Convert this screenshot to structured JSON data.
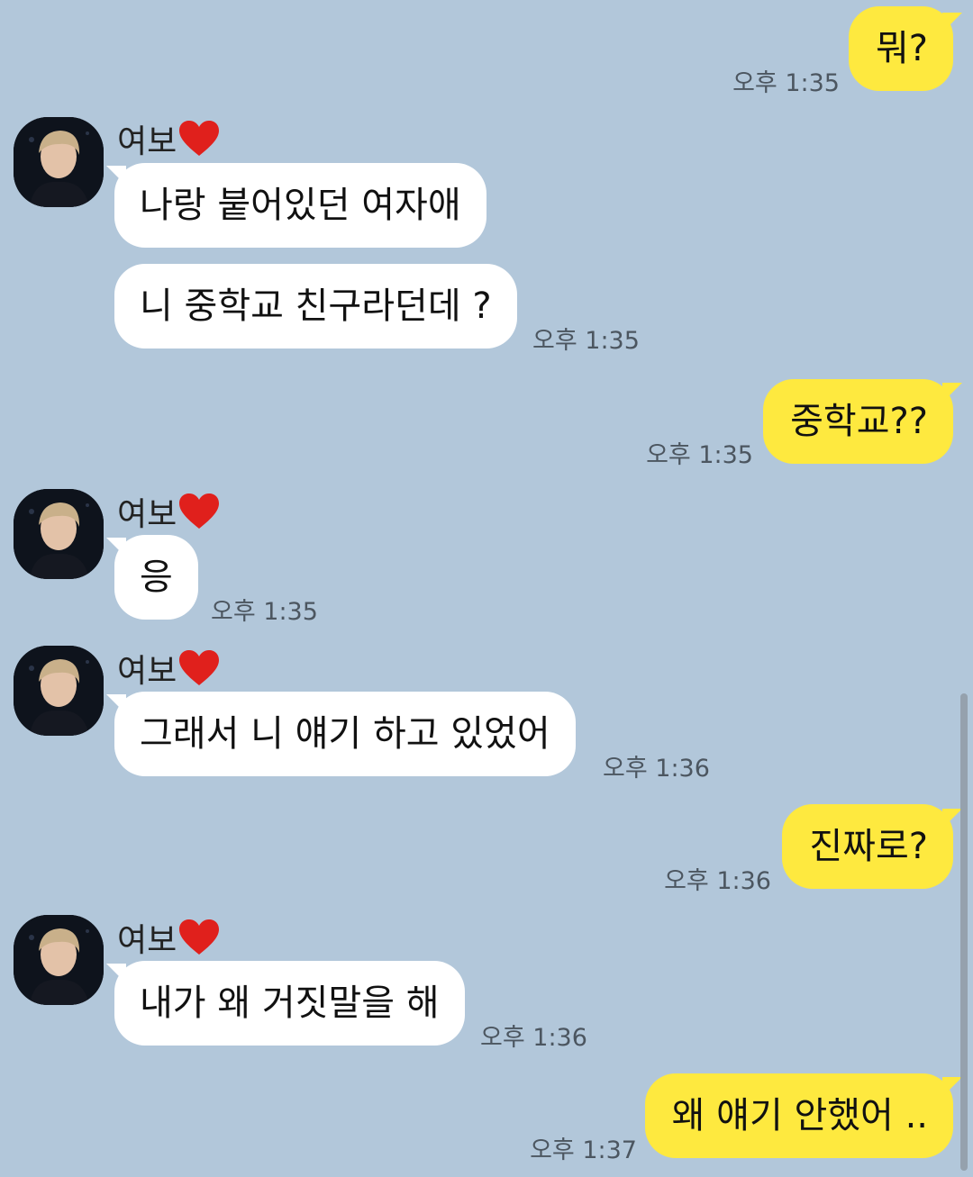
{
  "contact": {
    "name": "여보",
    "name_icon": "red-heart-icon",
    "avatar_icon": "profile-photo"
  },
  "colors": {
    "background": "#b2c7da",
    "my_bubble": "#fee93f",
    "other_bubble": "#ffffff"
  },
  "messages": [
    {
      "sender": "me",
      "text": "뭐?",
      "time": "오후 1:35"
    },
    {
      "sender": "other",
      "text": "나랑 붙어있던 여자애",
      "time": ""
    },
    {
      "sender": "other",
      "text": "니 중학교 친구라던데 ?",
      "time": "오후 1:35"
    },
    {
      "sender": "me",
      "text": "중학교??",
      "time": "오후 1:35"
    },
    {
      "sender": "other",
      "text": "응",
      "time": "오후 1:35"
    },
    {
      "sender": "other",
      "text": "그래서 니 얘기 하고 있었어",
      "time": "오후 1:36"
    },
    {
      "sender": "me",
      "text": "진짜로?",
      "time": "오후 1:36"
    },
    {
      "sender": "other",
      "text": "내가 왜 거짓말을 해",
      "time": "오후 1:36"
    },
    {
      "sender": "me",
      "text": "왜 얘기 안했어 ..",
      "time": "오후 1:37"
    }
  ]
}
